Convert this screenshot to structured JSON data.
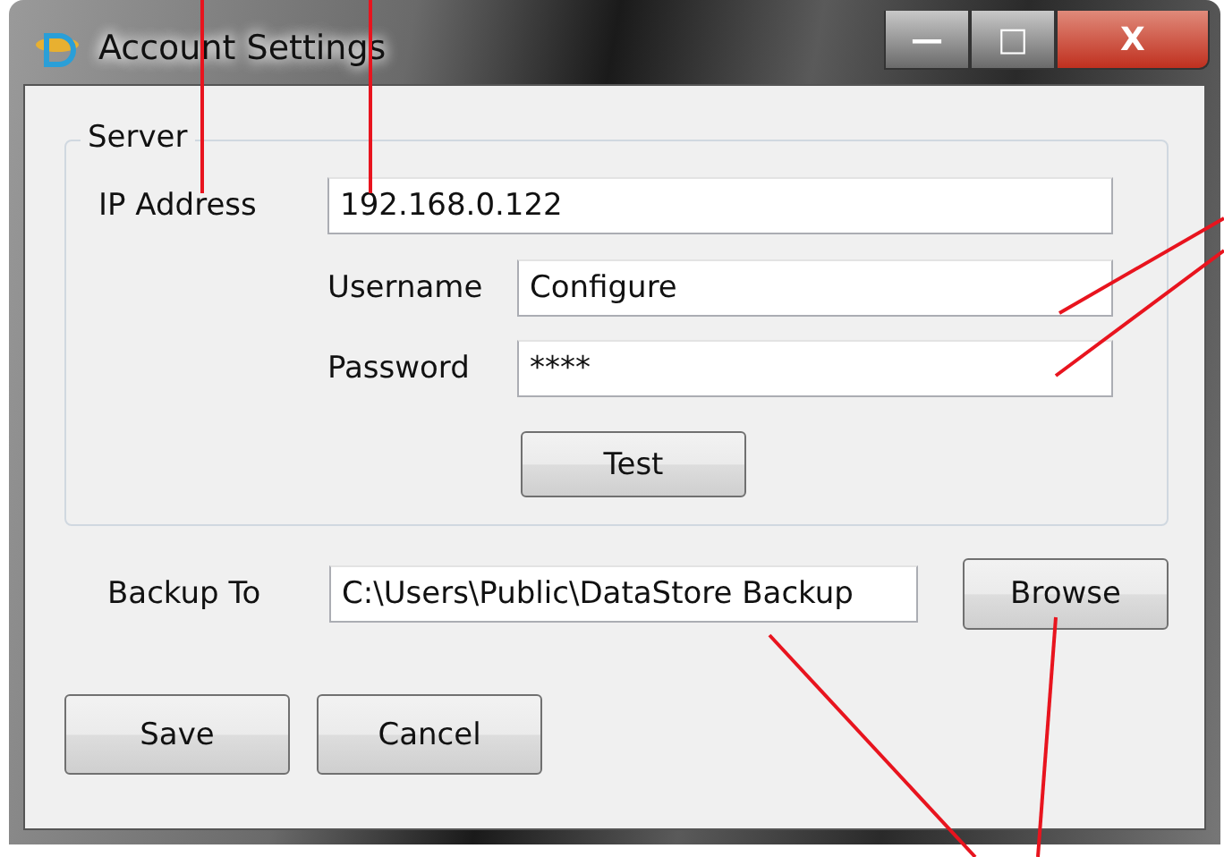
{
  "window": {
    "title": "Account Settings",
    "controls": [
      "—",
      "□",
      "X"
    ]
  },
  "server": {
    "title": "Server",
    "ip": {
      "label": "IP Address",
      "value": "192.168.0.122"
    },
    "username": {
      "label": "Username",
      "value": "Configure"
    },
    "password": {
      "label": "Password",
      "value": "****"
    },
    "test_button": "Test"
  },
  "backup": {
    "label": "Backup To",
    "value": "C:\\Users\\Public\\DataStore Backup",
    "browse_button": "Browse"
  },
  "buttons": [
    "Save",
    "Cancel"
  ]
}
